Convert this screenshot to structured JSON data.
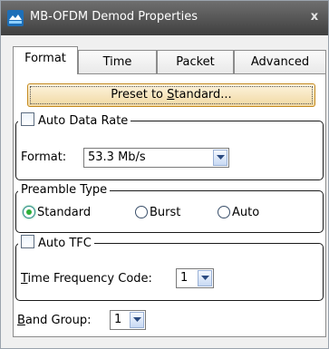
{
  "window": {
    "title": "MB-OFDM Demod Properties",
    "close_glyph": "x"
  },
  "tabs": [
    {
      "label": "Format",
      "active": true
    },
    {
      "label": "Time",
      "active": false
    },
    {
      "label": "Packet",
      "active": false
    },
    {
      "label": "Advanced",
      "active": false
    }
  ],
  "format_tab": {
    "preset_button": {
      "pre": "Preset to ",
      "mnemonic": "S",
      "post": "tandard..."
    },
    "data_rate_group": {
      "legend": "Auto Data Rate",
      "auto_checked": false,
      "format_label": "Format:",
      "format_value": "53.3 Mb/s"
    },
    "preamble_group": {
      "legend": "Preamble Type",
      "options": [
        "Standard",
        "Burst",
        "Auto"
      ],
      "selected": "Standard"
    },
    "tfc_group": {
      "legend": "Auto TFC",
      "auto_checked": false,
      "tfc_label_mnemonic": "T",
      "tfc_label_rest": "ime Frequency Code:",
      "tfc_value": "1"
    },
    "band_group": {
      "label_mnemonic": "B",
      "label_rest": "and Group:",
      "value": "1"
    }
  },
  "colors": {
    "titlebar": "#4f4f4f",
    "focus_button": "#f1d9a3",
    "radio_selected": "#2fb13a"
  }
}
